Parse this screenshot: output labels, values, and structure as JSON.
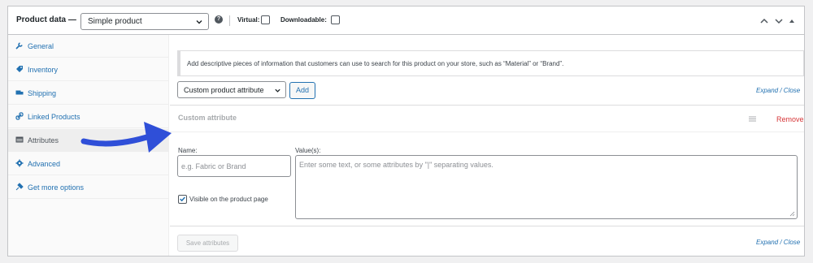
{
  "header": {
    "title": "Product data —",
    "product_type": "Simple product",
    "help_symbol": "?",
    "virtual_label": "Virtual:",
    "downloadable_label": "Downloadable:"
  },
  "tabs": [
    {
      "label": "General",
      "icon": "wrench-icon",
      "active": false
    },
    {
      "label": "Inventory",
      "icon": "tag-icon",
      "active": false
    },
    {
      "label": "Shipping",
      "icon": "truck-icon",
      "active": false
    },
    {
      "label": "Linked Products",
      "icon": "link-icon",
      "active": false
    },
    {
      "label": "Attributes",
      "icon": "list-icon",
      "active": true
    },
    {
      "label": "Advanced",
      "icon": "gear-icon",
      "active": false
    },
    {
      "label": "Get more options",
      "icon": "plugin-icon",
      "active": false
    }
  ],
  "notice": "Add descriptive pieces of information that customers can use to search for this product on your store, such as “Material” or “Brand”.",
  "attribute_select": "Custom product attribute",
  "add_button": "Add",
  "expand_close": "Expand / Close",
  "attribute": {
    "title": "Custom attribute",
    "remove": "Remove",
    "name_label": "Name:",
    "name_placeholder": "e.g. Fabric or Brand",
    "values_label": "Value(s):",
    "values_placeholder": "Enter some text, or some attributes by \"|\" separating values.",
    "visible_label": "Visible on the product page",
    "visible_checked": true
  },
  "save_button": "Save attributes",
  "colors": {
    "link": "#2271b1",
    "remove": "#d63638",
    "arrow": "#2f4fd8"
  }
}
